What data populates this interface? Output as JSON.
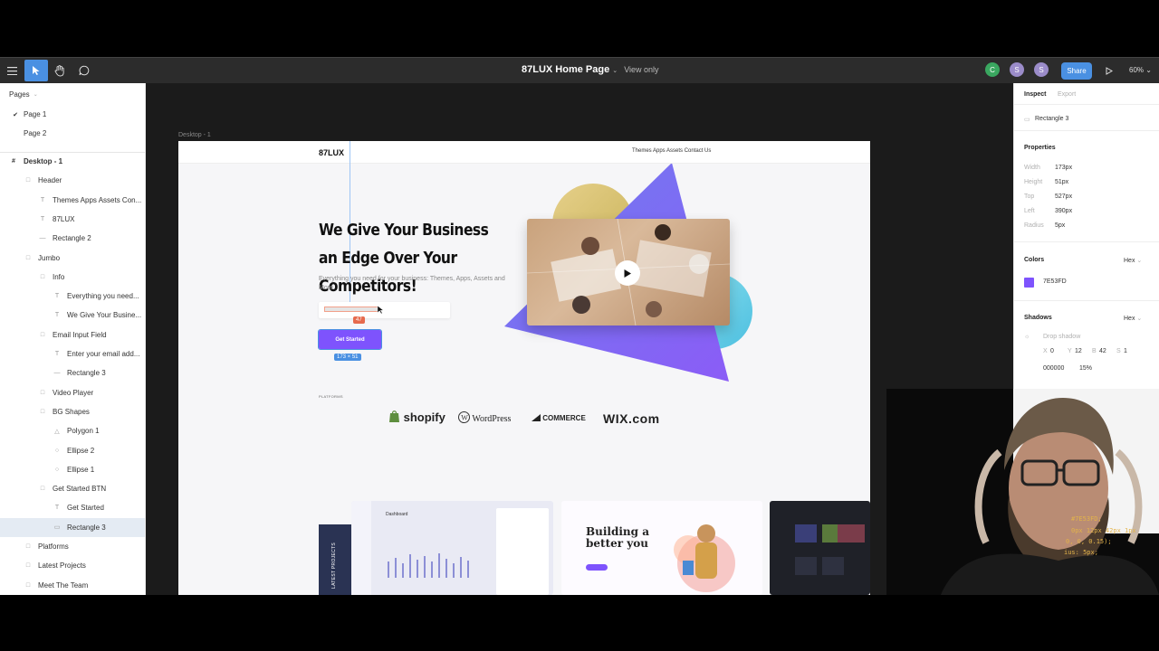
{
  "toolbar": {
    "doc_title": "87LUX Home Page",
    "view_mode": "View only",
    "avatars": [
      "C",
      "S",
      "S"
    ],
    "share_label": "Share",
    "zoom_label": "60%"
  },
  "left_panel": {
    "pages_header": "Pages",
    "pages": [
      {
        "label": "Page 1",
        "check": "✔"
      },
      {
        "label": "Page 2",
        "check": ""
      }
    ],
    "layers": [
      {
        "label": "Desktop - 1",
        "icon": "#"
      },
      {
        "label": "Header",
        "icon": "□"
      },
      {
        "label": "Themes Apps Assets Con...",
        "icon": "T"
      },
      {
        "label": "87LUX",
        "icon": "T"
      },
      {
        "label": "Rectangle 2",
        "icon": "—"
      },
      {
        "label": "Jumbo",
        "icon": "□"
      },
      {
        "label": "Info",
        "icon": "□"
      },
      {
        "label": "Everything you need...",
        "icon": "T"
      },
      {
        "label": "We Give Your Busine...",
        "icon": "T"
      },
      {
        "label": "Email Input Field",
        "icon": "□"
      },
      {
        "label": "Enter your email add...",
        "icon": "T"
      },
      {
        "label": "Rectangle 3",
        "icon": "—"
      },
      {
        "label": "Video Player",
        "icon": "□"
      },
      {
        "label": "BG Shapes",
        "icon": "□"
      },
      {
        "label": "Polygon 1",
        "icon": "△"
      },
      {
        "label": "Ellipse 2",
        "icon": "○"
      },
      {
        "label": "Ellipse 1",
        "icon": "○"
      },
      {
        "label": "Get Started BTN",
        "icon": "□"
      },
      {
        "label": "Get Started",
        "icon": "T"
      },
      {
        "label": "Rectangle 3",
        "icon": "▭"
      },
      {
        "label": "Platforms",
        "icon": "□"
      },
      {
        "label": "Latest Projects",
        "icon": "□"
      },
      {
        "label": "Meet The Team",
        "icon": "□"
      }
    ]
  },
  "canvas": {
    "frame_label": "Desktop - 1",
    "nav_logo": "87LUX",
    "nav_links": "Themes Apps Assets Contact Us",
    "hero_title": "We Give Your Business an Edge Over Your Competitors!",
    "hero_sub": "Everything you need for your business: Themes, Apps, Assets and More.",
    "cta_label": "Get Started",
    "dim_badge": "173 × 51",
    "num_badge": "47",
    "platforms_label": "PLATFORMS",
    "platform_logos": [
      "shopify",
      "WordPress",
      "COMMERCE",
      "WIX.com"
    ],
    "latest_projects_label": "LATEST PROJECTS",
    "card2_title": "Building a better you",
    "card1_title": "Dashboard"
  },
  "right_panel": {
    "tabs": [
      "Inspect",
      "Export"
    ],
    "layer_name": "Rectangle 3",
    "properties_header": "Properties",
    "properties": [
      {
        "label": "Width",
        "value": "173px"
      },
      {
        "label": "Height",
        "value": "51px"
      },
      {
        "label": "Top",
        "value": "527px"
      },
      {
        "label": "Left",
        "value": "390px"
      },
      {
        "label": "Radius",
        "value": "5px"
      }
    ],
    "colors_header": "Colors",
    "color_format": "Hex",
    "color_value": "7E53FD",
    "shadows_header": "Shadows",
    "shadow_format": "Hex",
    "shadow_type": "Drop shadow",
    "shadow_params": [
      {
        "label": "X",
        "value": "0"
      },
      {
        "label": "Y",
        "value": "12"
      },
      {
        "label": "B",
        "value": "42"
      },
      {
        "label": "S",
        "value": "1"
      }
    ],
    "shadow_color": "000000",
    "shadow_opacity": "15%"
  },
  "code_snippet": [
    "#7E53FD;",
    "0px 12px 42px 1px",
    "0, 0, 0.15);",
    "ius: 5px;"
  ],
  "colors": {
    "accent": "#7E53FD",
    "selection": "#4A90E2"
  }
}
